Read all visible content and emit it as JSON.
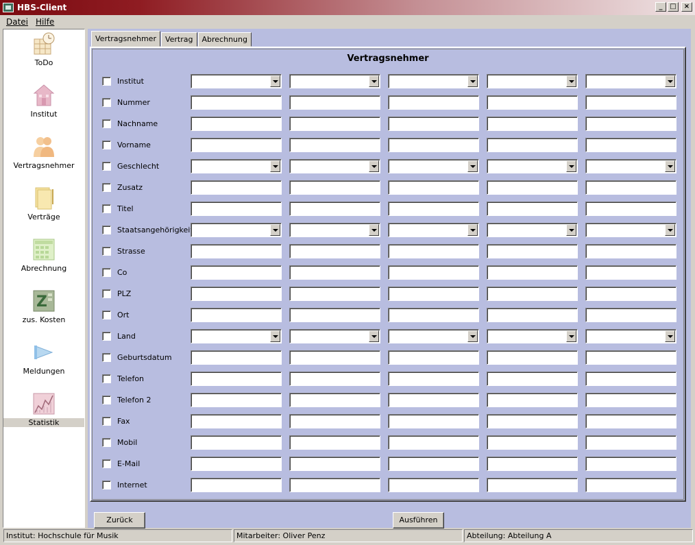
{
  "window": {
    "title": "HBS-Client",
    "buttons": [
      "_",
      "□",
      "×"
    ]
  },
  "menu": {
    "items": [
      "Datei",
      "Hilfe"
    ]
  },
  "sidebar": {
    "items": [
      {
        "label": "ToDo",
        "icon": "calendar-clock-icon"
      },
      {
        "label": "Institut",
        "icon": "house-icon"
      },
      {
        "label": "Vertragsnehmer",
        "icon": "people-icon"
      },
      {
        "label": "Verträge",
        "icon": "documents-pen-icon"
      },
      {
        "label": "Abrechnung",
        "icon": "calculator-table-icon"
      },
      {
        "label": "zus. Kosten",
        "icon": "z-calculator-icon"
      },
      {
        "label": "Meldungen",
        "icon": "megaphone-icon"
      },
      {
        "label": "Statistik",
        "icon": "chart-icon"
      }
    ],
    "active": "Statistik"
  },
  "tabs": [
    {
      "label": "Vertragsnehmer",
      "active": true
    },
    {
      "label": "Vertrag",
      "active": false
    },
    {
      "label": "Abrechnung",
      "active": false
    }
  ],
  "form": {
    "title": "Vertragsnehmer",
    "rows": [
      {
        "label": "Institut",
        "type": "combo"
      },
      {
        "label": "Nummer",
        "type": "text"
      },
      {
        "label": "Nachname",
        "type": "text"
      },
      {
        "label": "Vorname",
        "type": "text"
      },
      {
        "label": "Geschlecht",
        "type": "combo"
      },
      {
        "label": "Zusatz",
        "type": "text"
      },
      {
        "label": "Titel",
        "type": "text"
      },
      {
        "label": "Staatsangehörigkeit",
        "type": "combo"
      },
      {
        "label": "Strasse",
        "type": "text"
      },
      {
        "label": "Co",
        "type": "text"
      },
      {
        "label": "PLZ",
        "type": "text"
      },
      {
        "label": "Ort",
        "type": "text"
      },
      {
        "label": "Land",
        "type": "combo"
      },
      {
        "label": "Geburtsdatum",
        "type": "text"
      },
      {
        "label": "Telefon",
        "type": "text"
      },
      {
        "label": "Telefon 2",
        "type": "text"
      },
      {
        "label": "Fax",
        "type": "text"
      },
      {
        "label": "Mobil",
        "type": "text"
      },
      {
        "label": "E-Mail",
        "type": "text"
      },
      {
        "label": "Internet",
        "type": "text"
      }
    ]
  },
  "buttons": {
    "back": "Zurück",
    "execute": "Ausführen"
  },
  "status": {
    "institut": "Institut: Hochschule für Musik",
    "mitarbeiter": "Mitarbeiter: Oliver Penz",
    "abteilung": "Abteilung: Abteilung A"
  },
  "colors": {
    "title_bar": "#7a0a10",
    "panel_background": "#b8bde0",
    "chrome": "#d4d0c8"
  }
}
